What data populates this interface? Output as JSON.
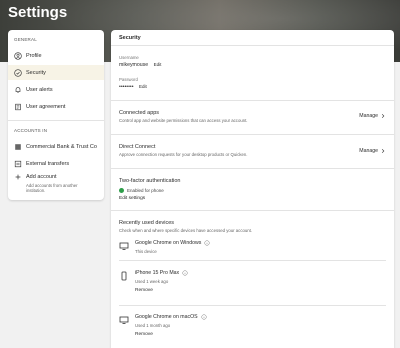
{
  "page": {
    "title": "Settings"
  },
  "sidebar": {
    "general_heading": "GENERAL",
    "items": [
      {
        "label": "Profile",
        "icon": "profile-icon",
        "active": false
      },
      {
        "label": "Security",
        "icon": "shield-icon",
        "active": true
      },
      {
        "label": "User alerts",
        "icon": "bell-icon",
        "active": false
      },
      {
        "label": "User agreement",
        "icon": "document-icon",
        "active": false
      }
    ],
    "accounts_heading": "ACCOUNTS IN",
    "accounts": [
      {
        "label": "Commercial Bank & Trust Co",
        "icon": "bank-icon"
      },
      {
        "label": "External transfers",
        "icon": "transfer-icon"
      }
    ],
    "add_account": {
      "label": "Add account",
      "sub": "Add accounts from another institution."
    }
  },
  "security": {
    "section_title": "Security",
    "username_label": "Username",
    "username_value": "mikeymouse",
    "password_label": "Password",
    "password_value": "••••••••",
    "edit_label": "Edit",
    "connected_apps": {
      "title": "Connected apps",
      "sub": "Control app and website permissions that can access your account.",
      "action": "Manage"
    },
    "direct_connect": {
      "title": "Direct Connect",
      "sub": "Approve connection requests for your desktop products or Quicken.",
      "action": "Manage"
    },
    "two_factor": {
      "title": "Two-factor authentication",
      "status": "Enabled for phone",
      "edit": "Edit settings"
    },
    "recent_devices": {
      "title": "Recently used devices",
      "sub": "Check when and where specific devices have accessed your account.",
      "devices": [
        {
          "name": "Google Chrome on Windows",
          "meta": "This device",
          "remove": "",
          "icon": "monitor-icon"
        },
        {
          "name": "iPhone 15 Pro Max",
          "meta": "Used 1 week ago",
          "remove": "Remove",
          "icon": "phone-icon"
        },
        {
          "name": "Google Chrome on macOS",
          "meta": "Used 1 month ago",
          "remove": "Remove",
          "icon": "monitor-icon"
        }
      ]
    }
  },
  "colors": {
    "active_bg": "#f7f3e6",
    "check_green": "#2e9e4a"
  }
}
